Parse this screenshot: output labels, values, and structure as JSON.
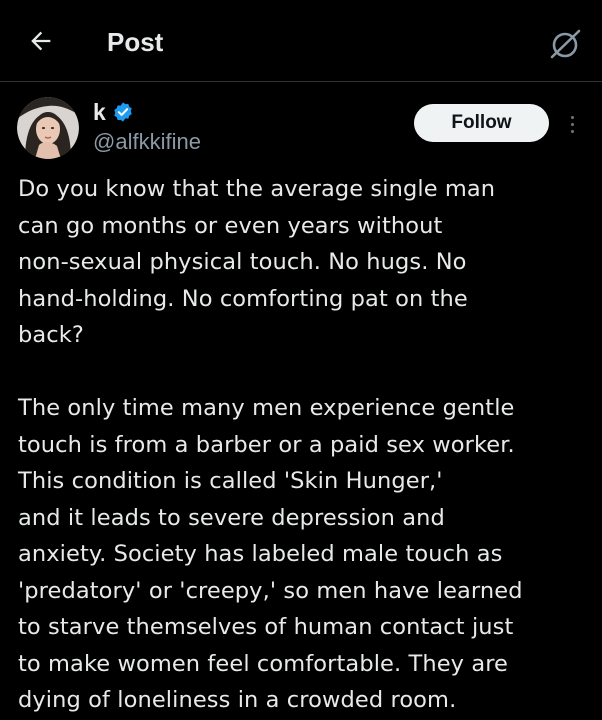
{
  "header": {
    "title": "Post",
    "back_icon": "arrow-left-icon",
    "grok_icon": "grok-icon"
  },
  "author": {
    "display_name": "k",
    "handle": "@alfkkifine",
    "verified": true,
    "verified_color": "#1d9bf0"
  },
  "actions": {
    "follow_label": "Follow",
    "more_icon": "more-vertical-icon"
  },
  "post": {
    "paragraph1_lines": [
      "Do you know that the average single man",
      "can go months or even years without",
      "non-sexual physical touch. No hugs. No",
      "hand-holding. No comforting pat on the",
      "back?"
    ],
    "paragraph2_lines": [
      "The only time many men experience gentle",
      "touch is from a barber or a paid sex worker.",
      "This condition is called 'Skin Hunger,'",
      "and it leads to severe depression and",
      "anxiety. Society has labeled male touch as",
      "'predatory' or 'creepy,' so men have learned",
      "to starve themselves of human contact just",
      "to make women feel comfortable. They are",
      "dying of loneliness in a crowded room."
    ]
  },
  "colors": {
    "background": "#000000",
    "text_primary": "#e7e9ea",
    "text_secondary": "#8b98a5",
    "divider": "#2f3336",
    "follow_bg": "#eff3f4"
  }
}
